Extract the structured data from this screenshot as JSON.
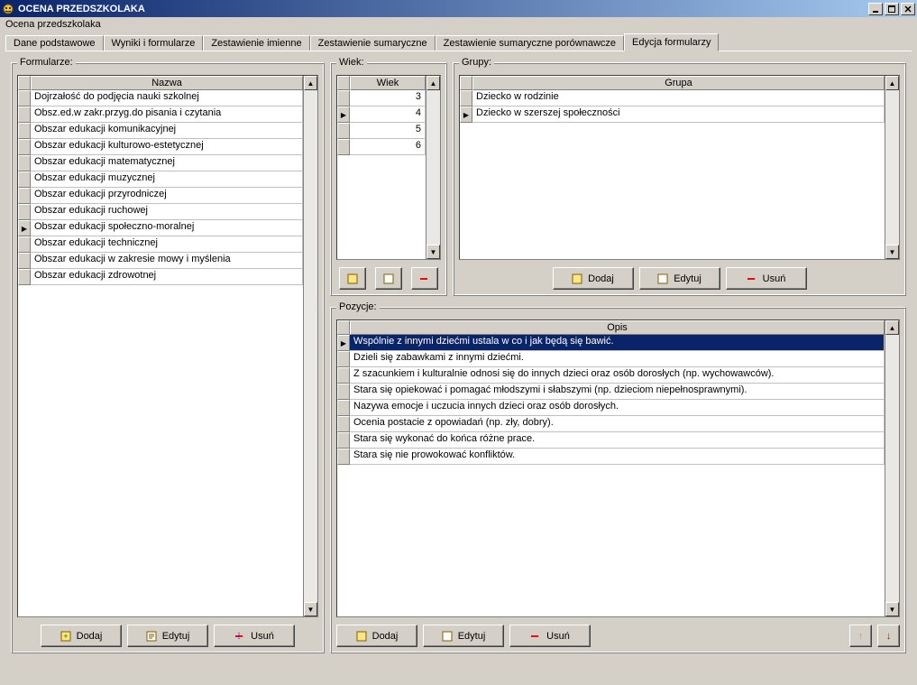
{
  "window": {
    "title": "OCENA PRZEDSZKOLAKA"
  },
  "subtitle": "Ocena przedszkolaka",
  "tabs": [
    {
      "label": "Dane podstawowe"
    },
    {
      "label": "Wyniki i formularze"
    },
    {
      "label": "Zestawienie imienne"
    },
    {
      "label": "Zestawienie sumaryczne"
    },
    {
      "label": "Zestawienie sumaryczne porównawcze"
    },
    {
      "label": "Edycja formularzy"
    }
  ],
  "panels": {
    "formularze": {
      "legend": "Formularze:",
      "header": "Nazwa",
      "rows": [
        {
          "text": "Dojrzałość do podjęcia nauki szkolnej"
        },
        {
          "text": "Obsz.ed.w zakr.przyg.do pisania i czytania"
        },
        {
          "text": "Obszar edukacji komunikacyjnej"
        },
        {
          "text": "Obszar edukacji kulturowo-estetycznej"
        },
        {
          "text": "Obszar edukacji matematycznej"
        },
        {
          "text": "Obszar edukacji muzycznej"
        },
        {
          "text": "Obszar edukacji przyrodniczej"
        },
        {
          "text": "Obszar edukacji ruchowej"
        },
        {
          "text": "Obszar edukacji społeczno-moralnej",
          "selected": true
        },
        {
          "text": "Obszar edukacji technicznej"
        },
        {
          "text": "Obszar edukacji w zakresie mowy i myślenia"
        },
        {
          "text": "Obszar edukacji zdrowotnej"
        }
      ]
    },
    "wiek": {
      "legend": "Wiek:",
      "header": "Wiek",
      "rows": [
        {
          "text": "3"
        },
        {
          "text": "4",
          "selected": true
        },
        {
          "text": "5"
        },
        {
          "text": "6"
        }
      ]
    },
    "grupy": {
      "legend": "Grupy:",
      "header": "Grupa",
      "rows": [
        {
          "text": "Dziecko w rodzinie"
        },
        {
          "text": "Dziecko w szerszej społeczności",
          "selected": true
        }
      ]
    },
    "pozycje": {
      "legend": "Pozycje:",
      "header": "Opis",
      "rows": [
        {
          "text": "Wspólnie z innymi dziećmi ustala w co i jak będą się bawić.",
          "highlighted": true,
          "selected": true
        },
        {
          "text": "Dzieli się zabawkami z innymi dziećmi."
        },
        {
          "text": "Z szacunkiem i kulturalnie odnosi się do innych dzieci oraz osób dorosłych (np. wychowawców)."
        },
        {
          "text": "Stara się opiekować i pomagać młodszymi i słabszymi (np. dzieciom niepełnosprawnymi)."
        },
        {
          "text": "Nazywa emocje i uczucia innych dzieci oraz osób dorosłych."
        },
        {
          "text": "Ocenia postacie z opowiadań (np. zły, dobry)."
        },
        {
          "text": "Stara się wykonać do końca różne prace."
        },
        {
          "text": "Stara się nie prowokować konfliktów."
        }
      ]
    }
  },
  "buttons": {
    "dodaj": "Dodaj",
    "edytuj": "Edytuj",
    "usun": "Usuń"
  }
}
